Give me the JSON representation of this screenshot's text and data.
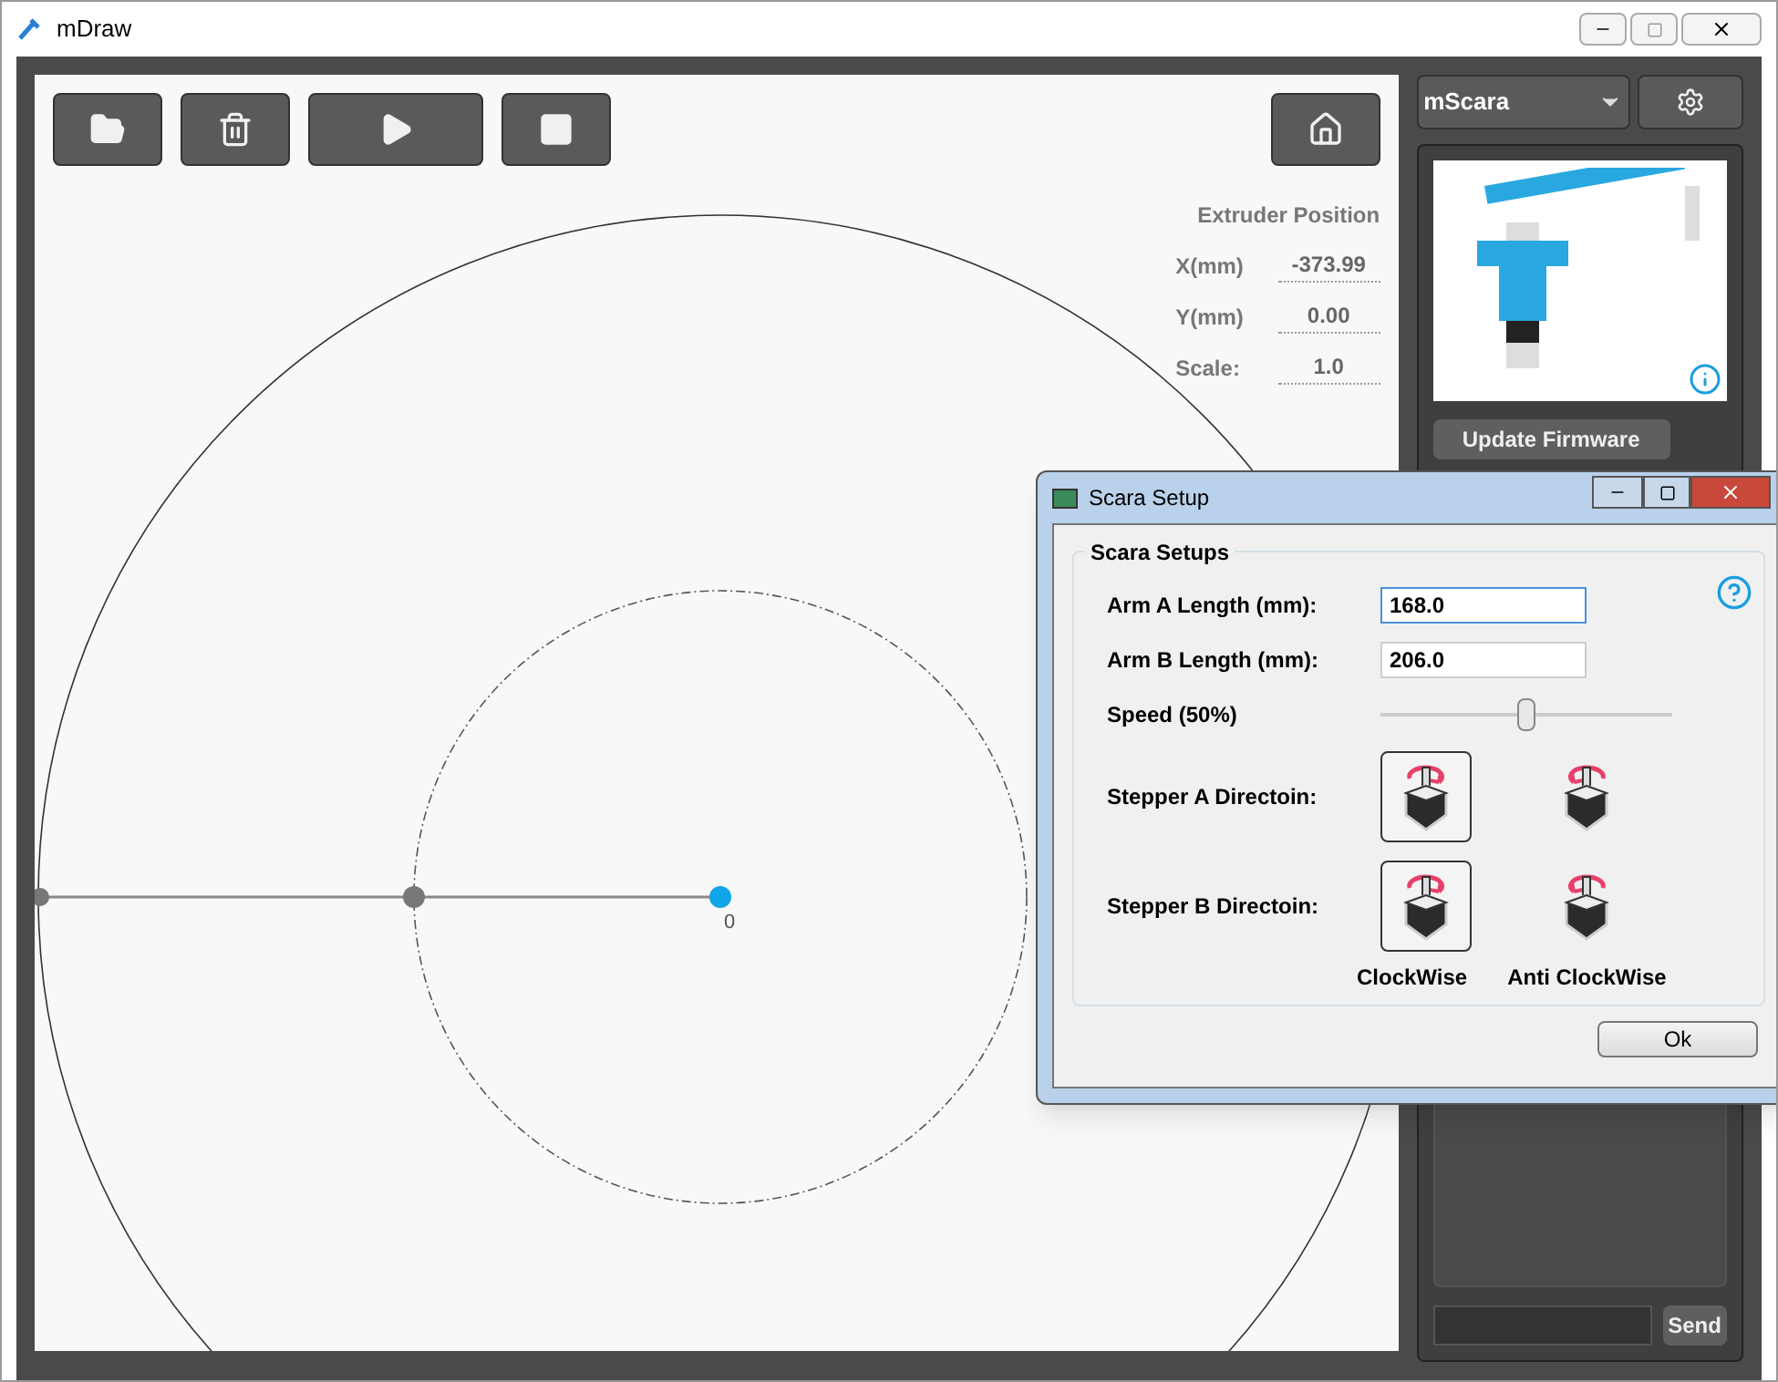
{
  "window": {
    "title": "mDraw"
  },
  "toolbar": {
    "buttons": [
      {
        "kind": "open"
      },
      {
        "kind": "delete"
      },
      {
        "kind": "play"
      },
      {
        "kind": "stop"
      }
    ],
    "home": {
      "kind": "home"
    }
  },
  "extruder": {
    "title": "Extruder Position",
    "fields": [
      {
        "label": "X(mm)",
        "value": "-373.99"
      },
      {
        "label": "Y(mm)",
        "value": "0.00"
      },
      {
        "label": "Scale:",
        "value": "1.0"
      }
    ]
  },
  "canvas": {
    "origin_label": "0"
  },
  "sidebar": {
    "model": "mScara",
    "firmware_button": "Update Firmware",
    "send_button": "Send"
  },
  "dialog": {
    "title": "Scara Setup",
    "group": "Scara Setups",
    "fields": [
      {
        "label": "Arm A Length (mm):",
        "value": "168.0",
        "focused": true
      },
      {
        "label": "Arm B Length (mm):",
        "value": "206.0",
        "focused": false
      }
    ],
    "speed": {
      "label": "Speed (50%)",
      "level": 0.5
    },
    "steppers": [
      {
        "label": "Stepper A Directoin:",
        "options": [
          {
            "kind": "clockwise",
            "selected": true
          },
          {
            "kind": "anticlockwise",
            "selected": false
          }
        ]
      },
      {
        "label": "Stepper B Directoin:",
        "options": [
          {
            "kind": "clockwise",
            "selected": true
          },
          {
            "kind": "anticlockwise",
            "selected": false
          }
        ]
      }
    ],
    "option_labels": [
      "ClockWise",
      "Anti ClockWise"
    ],
    "ok_button": "Ok"
  }
}
